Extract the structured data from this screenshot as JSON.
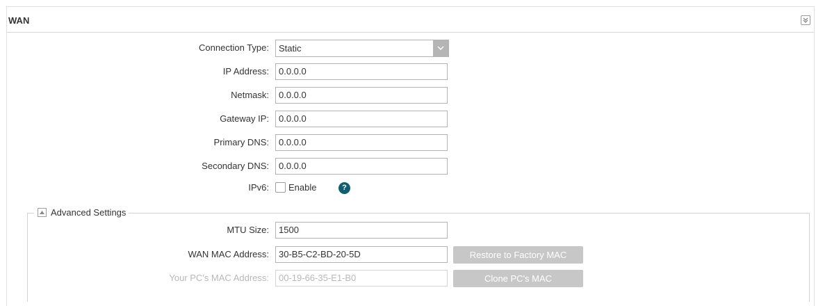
{
  "panel": {
    "title": "WAN"
  },
  "form": {
    "connection_type": {
      "label": "Connection Type:",
      "value": "Static"
    },
    "ip_address": {
      "label": "IP Address:",
      "value": "0.0.0.0"
    },
    "netmask": {
      "label": "Netmask:",
      "value": "0.0.0.0"
    },
    "gateway_ip": {
      "label": "Gateway IP:",
      "value": "0.0.0.0"
    },
    "primary_dns": {
      "label": "Primary DNS:",
      "value": "0.0.0.0"
    },
    "secondary_dns": {
      "label": "Secondary DNS:",
      "value": "0.0.0.0"
    },
    "ipv6": {
      "label": "IPv6:",
      "checkbox_label": "Enable",
      "checked": false,
      "help": "?"
    }
  },
  "advanced": {
    "title": "Advanced Settings",
    "mtu": {
      "label": "MTU Size:",
      "value": "1500"
    },
    "wan_mac": {
      "label": "WAN MAC Address:",
      "value": "30-B5-C2-BD-20-5D",
      "button": "Restore to Factory MAC"
    },
    "pc_mac": {
      "label": "Your PC's MAC Address:",
      "value": "00-19-66-35-E1-B0",
      "button": "Clone PC's MAC"
    }
  },
  "colors": {
    "help_icon": "#0f5e72",
    "button_disabled": "#c7c7c7",
    "select_arrow": "#b5b5b5"
  }
}
